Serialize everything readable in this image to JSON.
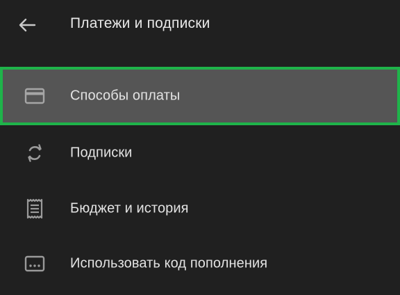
{
  "header": {
    "back_icon": "arrow-left-icon",
    "title": "Платежи и подписки"
  },
  "menu": {
    "items": [
      {
        "label": "Способы оплаты",
        "icon": "credit-card-icon",
        "selected": true
      },
      {
        "label": "Подписки",
        "icon": "refresh-icon",
        "selected": false
      },
      {
        "label": "Бюджет и история",
        "icon": "receipt-icon",
        "selected": false
      },
      {
        "label": "Использовать код пополнения",
        "icon": "gift-card-icon",
        "selected": false
      }
    ]
  },
  "colors": {
    "background": "#202020",
    "selected_background": "#555555",
    "focus_outline": "#1fb34a",
    "text": "#e3e3e3",
    "icon": "#9a9a9a"
  }
}
